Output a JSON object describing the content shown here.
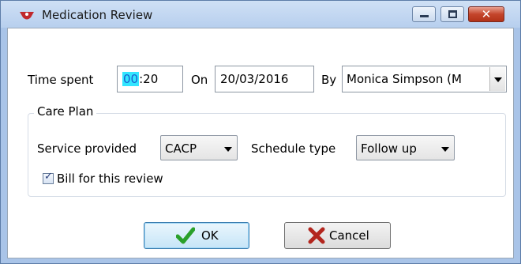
{
  "window": {
    "title": "Medication Review",
    "icon": "medication-app-icon",
    "controls": {
      "minimize": "minimize-icon",
      "maximize": "maximize-icon",
      "close": "close-icon"
    }
  },
  "row1": {
    "time_label": "Time spent",
    "time_hours": "00",
    "time_minutes": ":20",
    "on_label": "On",
    "date_value": "20/03/2016",
    "by_label": "By",
    "by_value": "Monica Simpson (M"
  },
  "care_plan": {
    "title": "Care Plan",
    "service_label": "Service provided",
    "service_value": "CACP",
    "schedule_label": "Schedule type",
    "schedule_value": "Follow up",
    "bill_label": "Bill for this review",
    "bill_checked": true
  },
  "buttons": {
    "ok_label": "OK",
    "cancel_label": "Cancel"
  },
  "colors": {
    "title_bar": "#b7cfee",
    "frame": "#a9c4e8",
    "time_highlight": "#33e6ff",
    "ok_icon": "#2aa02a",
    "cancel_icon": "#b3261e"
  }
}
